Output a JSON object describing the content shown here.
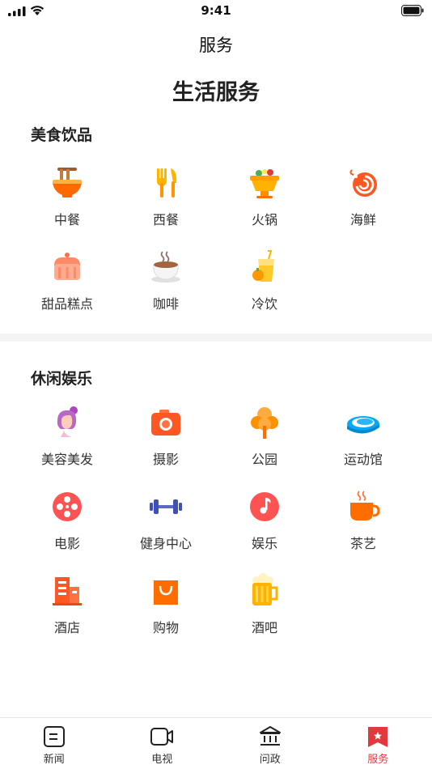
{
  "status_bar": {
    "time": "9:41"
  },
  "header": {
    "title": "服务"
  },
  "page": {
    "title": "生活服务"
  },
  "sections": [
    {
      "title": "美食饮品",
      "items": [
        {
          "label": "中餐",
          "icon": "noodle-bowl-icon"
        },
        {
          "label": "西餐",
          "icon": "fork-knife-icon"
        },
        {
          "label": "火锅",
          "icon": "hotpot-icon"
        },
        {
          "label": "海鲜",
          "icon": "shrimp-icon"
        },
        {
          "label": "甜品糕点",
          "icon": "cake-icon"
        },
        {
          "label": "咖啡",
          "icon": "coffee-cup-icon"
        },
        {
          "label": "冷饮",
          "icon": "cold-drink-icon"
        }
      ]
    },
    {
      "title": "休闲娱乐",
      "items": [
        {
          "label": "美容美发",
          "icon": "hair-salon-icon"
        },
        {
          "label": "摄影",
          "icon": "camera-icon"
        },
        {
          "label": "公园",
          "icon": "tree-icon"
        },
        {
          "label": "运动馆",
          "icon": "stadium-icon"
        },
        {
          "label": "电影",
          "icon": "film-reel-icon"
        },
        {
          "label": "健身中心",
          "icon": "dumbbell-icon"
        },
        {
          "label": "娱乐",
          "icon": "music-note-icon"
        },
        {
          "label": "茶艺",
          "icon": "tea-cup-icon"
        },
        {
          "label": "酒店",
          "icon": "hotel-building-icon"
        },
        {
          "label": "购物",
          "icon": "shopping-bag-icon"
        },
        {
          "label": "酒吧",
          "icon": "beer-mug-icon"
        }
      ]
    }
  ],
  "tabbar": {
    "items": [
      {
        "label": "新闻",
        "icon": "news-icon"
      },
      {
        "label": "电视",
        "icon": "video-camera-icon"
      },
      {
        "label": "问政",
        "icon": "government-building-icon"
      },
      {
        "label": "服务",
        "icon": "bookmark-star-icon",
        "active": true
      }
    ]
  },
  "colors": {
    "accent": "#e4393c",
    "icon_orange": "#ff7a1a"
  }
}
